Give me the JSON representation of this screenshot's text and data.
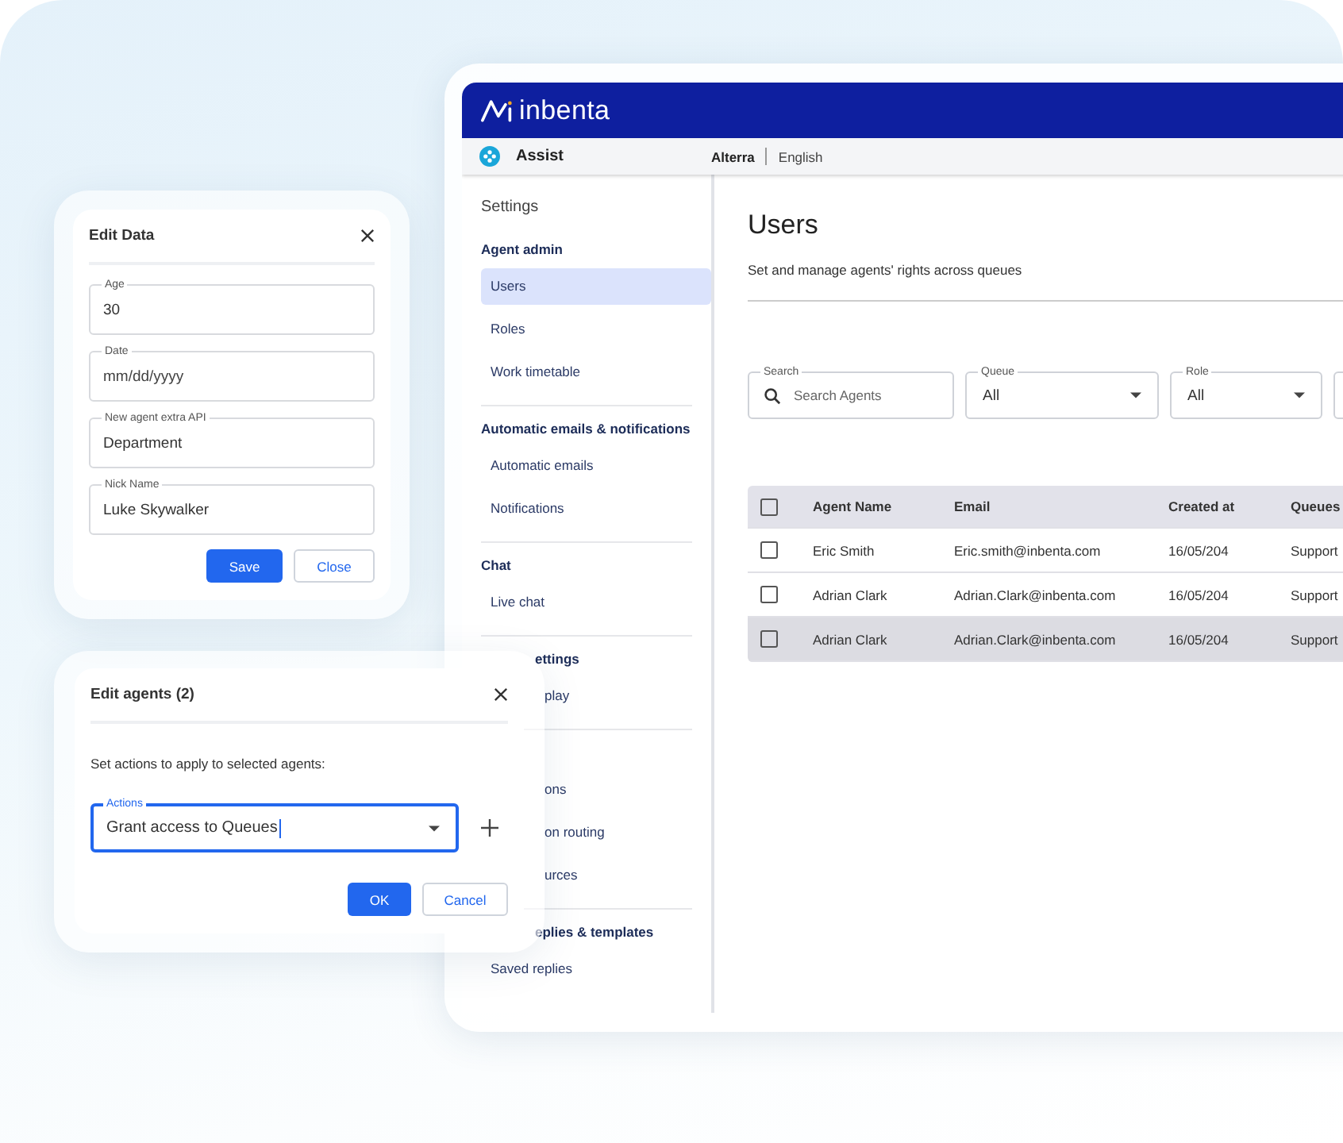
{
  "app": {
    "logo_text": "inbenta",
    "product": "Assist",
    "account": "Alterra",
    "language": "English"
  },
  "sidebar": {
    "title": "Settings",
    "sections": [
      {
        "heading": {
          "text": "Agent admin",
          "kind": "full"
        },
        "items": [
          {
            "label": "Users",
            "kind": "full",
            "selected": true
          },
          {
            "label": "Roles",
            "kind": "full",
            "selected": false
          },
          {
            "label": "Work timetable",
            "kind": "full",
            "selected": false
          }
        ]
      },
      {
        "heading": {
          "text": "Automatic emails & notifications",
          "kind": "full"
        },
        "items": [
          {
            "label": "Automatic emails",
            "kind": "full",
            "selected": false
          },
          {
            "label": "Notifications",
            "kind": "full",
            "selected": false
          }
        ]
      },
      {
        "heading": {
          "text": "Chat",
          "kind": "full"
        },
        "items": [
          {
            "label": "Live chat",
            "kind": "full",
            "selected": false
          }
        ]
      },
      {
        "heading": {
          "text": "ettings",
          "kind": "partial"
        },
        "items": [
          {
            "label": "play",
            "kind": "partial",
            "selected": false
          }
        ]
      },
      {
        "items": [
          {
            "label": "ons",
            "kind": "partial",
            "selected": false
          },
          {
            "label": "on routing",
            "kind": "partial",
            "selected": false
          },
          {
            "label": "urces",
            "kind": "partial",
            "selected": false
          }
        ]
      },
      {
        "heading": {
          "text": "eplies & templates",
          "kind": "partial"
        },
        "items": [
          {
            "label": "Saved replies",
            "kind": "full",
            "selected": false
          }
        ]
      }
    ]
  },
  "page": {
    "title": "Users",
    "subtitle": "Set and manage agents' rights across queues"
  },
  "filters": [
    {
      "kind": "search",
      "label": "Search",
      "placeholder": "Search Agents"
    },
    {
      "kind": "select",
      "label": "Queue",
      "value": "All"
    },
    {
      "kind": "select",
      "label": "Role",
      "value": "All"
    },
    {
      "kind": "cut"
    }
  ],
  "table": {
    "all_checked": false,
    "columns": [
      "Agent Name",
      "Email",
      "Created at",
      "Queues"
    ],
    "rows": [
      {
        "cells": [
          "Eric Smith",
          "Eric.smith@inbenta.com",
          "16/05/204",
          "Support"
        ],
        "checked": false,
        "selected": false
      },
      {
        "cells": [
          "Adrian Clark",
          "Adrian.Clark@inbenta.com",
          "16/05/204",
          "Support"
        ],
        "checked": false,
        "selected": false
      },
      {
        "cells": [
          "Adrian Clark",
          "Adrian.Clark@inbenta.com",
          "16/05/204",
          "Support"
        ],
        "checked": false,
        "selected": true
      }
    ]
  },
  "edit_data_dialog": {
    "title": "Edit Data",
    "fields": [
      {
        "label": "Age",
        "value": "30"
      },
      {
        "label": "Date",
        "placeholder": "mm/dd/yyyy"
      },
      {
        "label": "New agent extra API",
        "value": "Department"
      },
      {
        "label": "Nick Name",
        "value": "Luke Skywalker"
      }
    ],
    "buttons": [
      {
        "label": "Save",
        "kind": "primary"
      },
      {
        "label": "Close",
        "kind": "secondary"
      }
    ]
  },
  "edit_agents_dialog": {
    "title": "Edit agents (2)",
    "text": "Set actions to apply to selected agents:",
    "field": {
      "label": "Actions",
      "value": "Grant access to Queues",
      "focused": true
    },
    "buttons": [
      {
        "label": "OK",
        "kind": "primary"
      },
      {
        "label": "Cancel",
        "kind": "secondary"
      }
    ]
  }
}
